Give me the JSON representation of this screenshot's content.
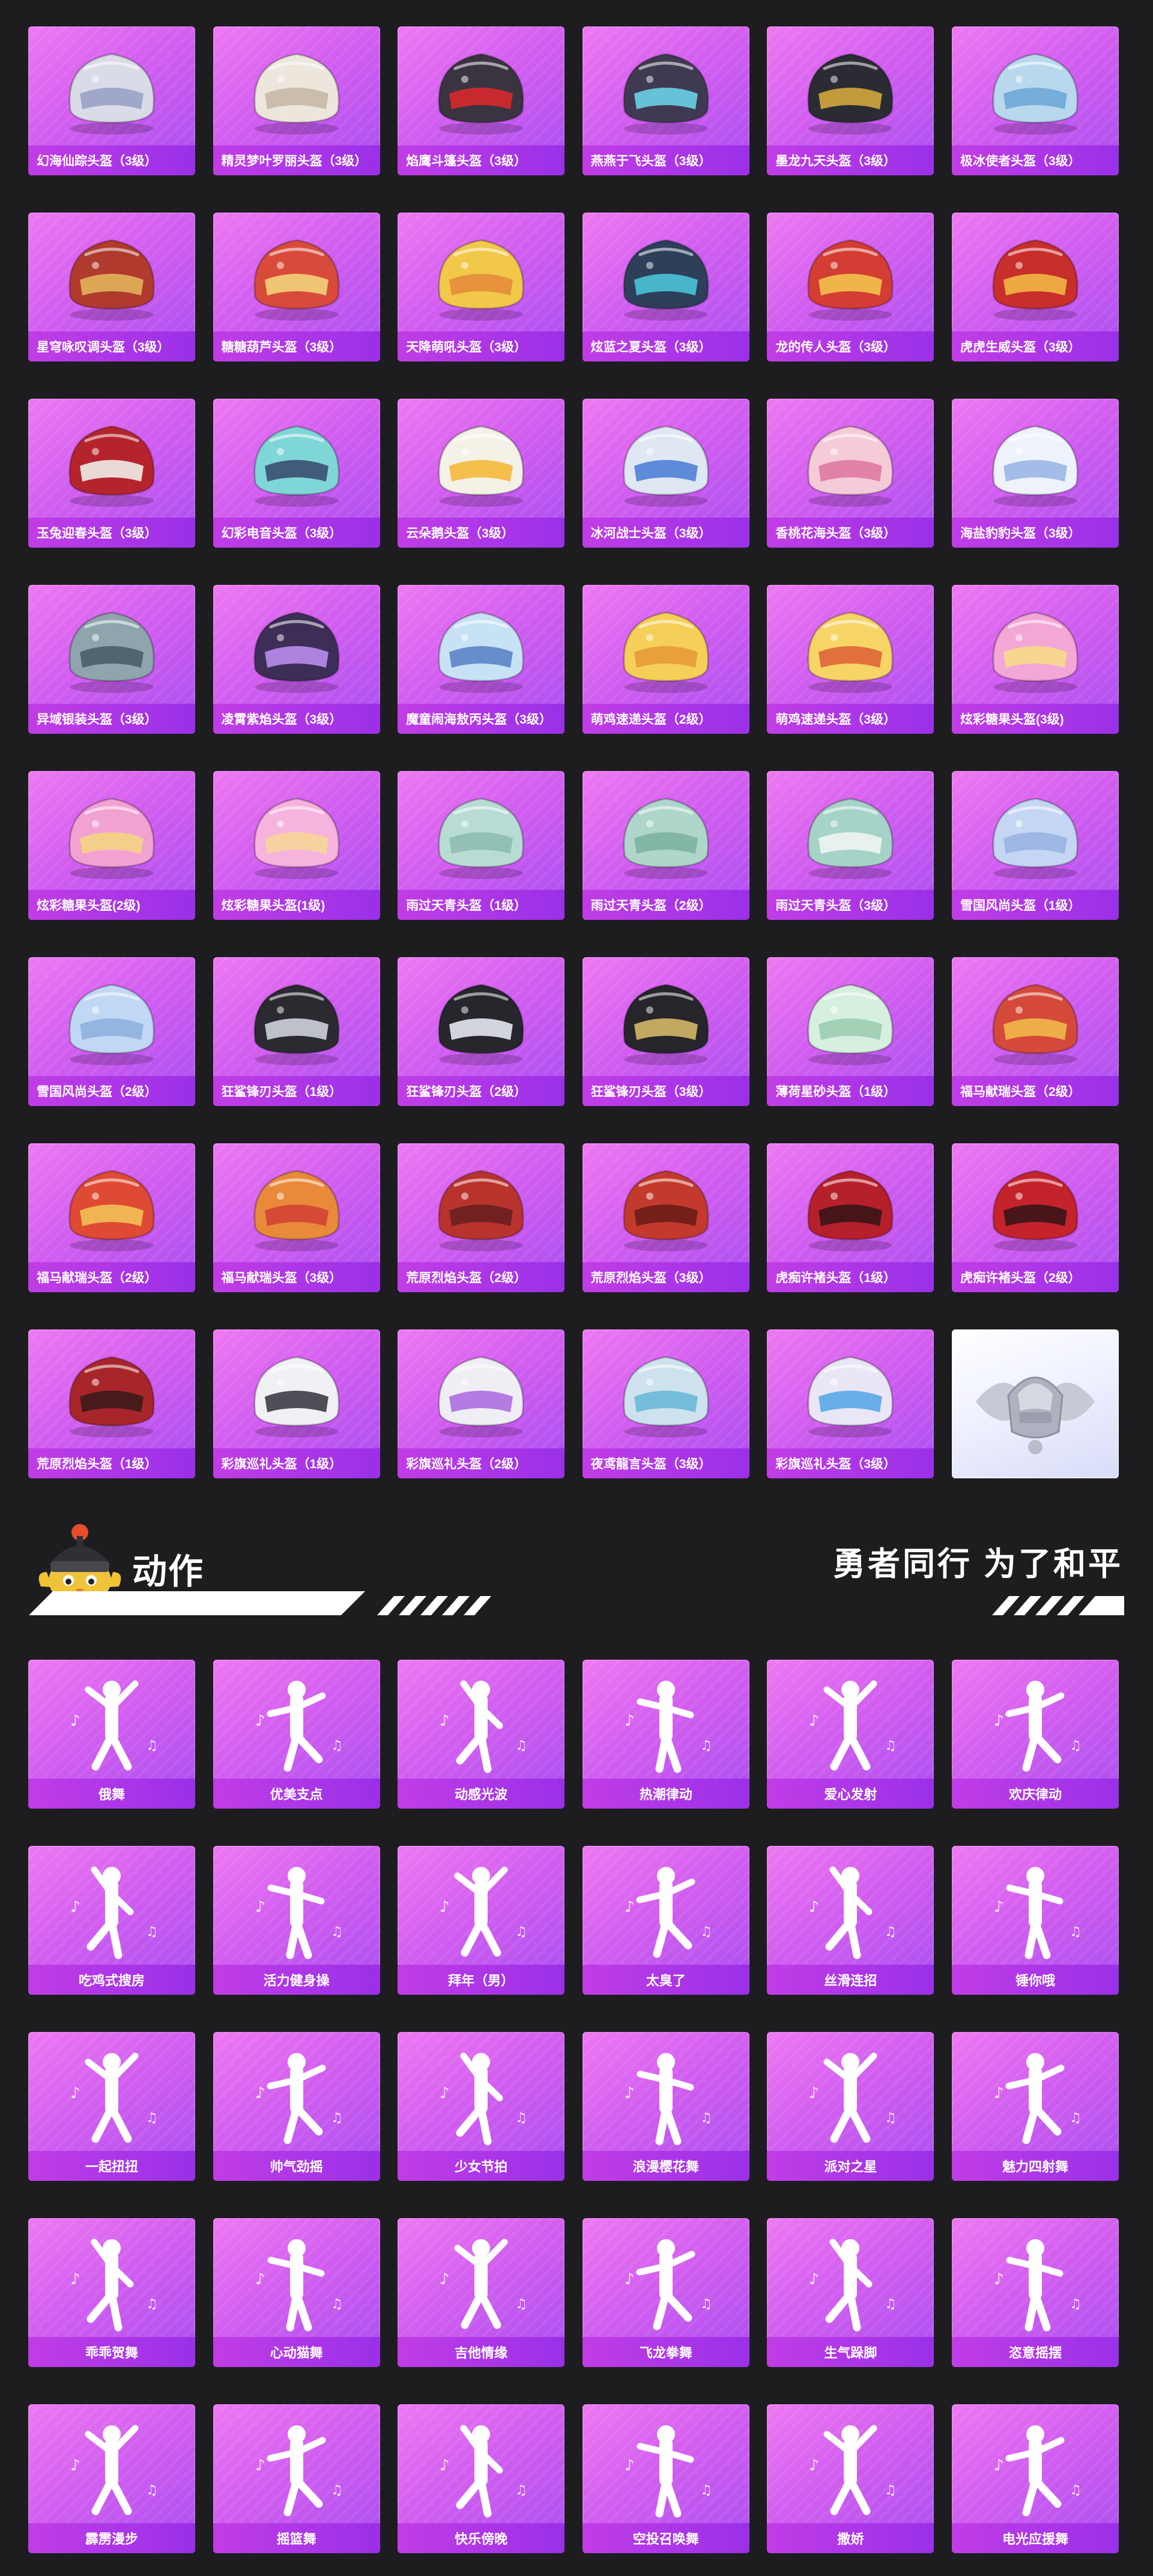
{
  "helmets": [
    {
      "name": "幻海仙踪头盔（3级）",
      "color": "#d9dbe6",
      "accent": "#9aa0c8"
    },
    {
      "name": "精灵梦叶罗丽头盔（3级）",
      "color": "#ece6dc",
      "accent": "#c7b8a6"
    },
    {
      "name": "焰鹰斗篷头盔（3级）",
      "color": "#3a3440",
      "accent": "#d8282c"
    },
    {
      "name": "燕燕于飞头盔（3级）",
      "color": "#3f3a52",
      "accent": "#6ad2e6"
    },
    {
      "name": "墨龙九天头盔（3级）",
      "color": "#2b2b33",
      "accent": "#d2a63c"
    },
    {
      "name": "极冰使者头盔（3级）",
      "color": "#b9d8ee",
      "accent": "#6fa8d6"
    },
    {
      "name": "星穹咏叹调头盔（3级）",
      "color": "#b13a2e",
      "accent": "#e2b25a"
    },
    {
      "name": "糖糖葫芦头盔（3级）",
      "color": "#d84b3a",
      "accent": "#f2d37a"
    },
    {
      "name": "天降萌吼头盔（3级）",
      "color": "#f1c84a",
      "accent": "#e58d3a"
    },
    {
      "name": "炫蓝之夏头盔（3级）",
      "color": "#2d3f59",
      "accent": "#4ac2d6"
    },
    {
      "name": "龙的传人头盔（3级）",
      "color": "#d43d34",
      "accent": "#f2c24c"
    },
    {
      "name": "虎虎生威头盔（3级）",
      "color": "#c82e2a",
      "accent": "#f0b744"
    },
    {
      "name": "玉兔迎春头盔（3级）",
      "color": "#b5242c",
      "accent": "#f0eee8"
    },
    {
      "name": "幻彩电音头盔（3级）",
      "color": "#7fd6d6",
      "accent": "#3b4e70"
    },
    {
      "name": "云朵鹅头盔（3级）",
      "color": "#f4f1e6",
      "accent": "#f5b93b"
    },
    {
      "name": "冰河战士头盔（3级）",
      "color": "#dfe7f3",
      "accent": "#4f7fd6"
    },
    {
      "name": "香桃花海头盔（3级）",
      "color": "#f6cbd8",
      "accent": "#e17aa3"
    },
    {
      "name": "海盐豹豹头盔（3级）",
      "color": "#eef3fb",
      "accent": "#9ab7e5"
    },
    {
      "name": "异域银装头盔（3级）",
      "color": "#8fa4ad",
      "accent": "#4a5e6a"
    },
    {
      "name": "凌霄紫焰头盔（3级）",
      "color": "#3d2e58",
      "accent": "#b98df0"
    },
    {
      "name": "魔童闹海敖丙头盔（3级）",
      "color": "#c7e2f4",
      "accent": "#5d84c8"
    },
    {
      "name": "萌鸡速递头盔（2级）",
      "color": "#f6cf58",
      "accent": "#e59a3a"
    },
    {
      "name": "萌鸡速递头盔（3级）",
      "color": "#f6d466",
      "accent": "#e0643a"
    },
    {
      "name": "炫彩糖果头盔(3级)",
      "color": "#f3a7d7",
      "accent": "#f6dc8a"
    },
    {
      "name": "炫彩糖果头盔(2级)",
      "color": "#f2a2d2",
      "accent": "#f4d483"
    },
    {
      "name": "炫彩糖果头盔(1级)",
      "color": "#f6b3dd",
      "accent": "#f6d59a"
    },
    {
      "name": "雨过天青头盔（1级）",
      "color": "#b8dcd3",
      "accent": "#8fbcb0"
    },
    {
      "name": "雨过天青头盔（2级）",
      "color": "#aed6cb",
      "accent": "#7fb2a4"
    },
    {
      "name": "雨过天青头盔（3级）",
      "color": "#a6d3c8",
      "accent": "#f0f4f2"
    },
    {
      "name": "雪国风尚头盔（1级）",
      "color": "#c4d6f3",
      "accent": "#9ab4e2"
    },
    {
      "name": "雪国风尚头盔（2级）",
      "color": "#c0d8f4",
      "accent": "#8fb0e0"
    },
    {
      "name": "狂鲨锋刃头盔（1级）",
      "color": "#2a2a30",
      "accent": "#cfd2da"
    },
    {
      "name": "狂鲨锋刃头盔（2级）",
      "color": "#26262c",
      "accent": "#e6e8ee"
    },
    {
      "name": "狂鲨锋刃头盔（3级）",
      "color": "#25252b",
      "accent": "#d4b766"
    },
    {
      "name": "薄荷星砂头盔（1级）",
      "color": "#d6efdf",
      "accent": "#9ccdb0"
    },
    {
      "name": "福马献瑞头盔（2级）",
      "color": "#d4493a",
      "accent": "#f0b84a"
    },
    {
      "name": "福马献瑞头盔（2级）",
      "color": "#de4a33",
      "accent": "#f3c056"
    },
    {
      "name": "福马献瑞头盔（3级）",
      "color": "#e88a3a",
      "accent": "#d24234"
    },
    {
      "name": "荒原烈焰头盔（2级）",
      "color": "#b8332c",
      "accent": "#6a1f1f"
    },
    {
      "name": "荒原烈焰头盔（3级）",
      "color": "#c33a2c",
      "accent": "#6d1d1a"
    },
    {
      "name": "虎痴许褚头盔（1级）",
      "color": "#b6202a",
      "accent": "#3a1418"
    },
    {
      "name": "虎痴许褚头盔（2级）",
      "color": "#c4232c",
      "accent": "#3a1418"
    },
    {
      "name": "荒原烈焰头盔（1级）",
      "color": "#a8262a",
      "accent": "#3c1a1a"
    },
    {
      "name": "彩旗巡礼头盔（1级）",
      "color": "#f1f1f5",
      "accent": "#3c3c46"
    },
    {
      "name": "彩旗巡礼头盔（2级）",
      "color": "#eeeef4",
      "accent": "#ad6fe0"
    },
    {
      "name": "夜鸢龍言头盔（3级）",
      "color": "#cde2ee",
      "accent": "#6ab8d6"
    },
    {
      "name": "彩旗巡礼头盔（3级）",
      "color": "#e9e7f6",
      "accent": "#5aa7e8"
    }
  ],
  "logo_tile": {
    "name": "pubg-emblem"
  },
  "section": {
    "title": "动作",
    "slogan": "勇者同行 为了和平"
  },
  "emotes": [
    {
      "name": "俄舞"
    },
    {
      "name": "优美支点"
    },
    {
      "name": "动感光波"
    },
    {
      "name": "热潮律动"
    },
    {
      "name": "爱心发射"
    },
    {
      "name": "欢庆律动"
    },
    {
      "name": "吃鸡式搜房"
    },
    {
      "name": "活力健身操"
    },
    {
      "name": "拜年（男）"
    },
    {
      "name": "太臭了"
    },
    {
      "name": "丝滑连招"
    },
    {
      "name": "锤你哦"
    },
    {
      "name": "一起扭扭"
    },
    {
      "name": "帅气劲摇"
    },
    {
      "name": "少女节拍"
    },
    {
      "name": "浪漫樱花舞"
    },
    {
      "name": "派对之星"
    },
    {
      "name": "魅力四射舞"
    },
    {
      "name": "乖乖贺舞"
    },
    {
      "name": "心动猫舞"
    },
    {
      "name": "吉他情缘"
    },
    {
      "name": "飞龙拳舞"
    },
    {
      "name": "生气跺脚"
    },
    {
      "name": "恣意摇摆"
    },
    {
      "name": "霹雳漫步"
    },
    {
      "name": "摇篮舞"
    },
    {
      "name": "快乐傍晚"
    },
    {
      "name": "空投召唤舞"
    },
    {
      "name": "撒娇"
    },
    {
      "name": "电光应援舞"
    }
  ],
  "colors": {
    "background": "#1d1d1f",
    "card_gradient_start": "#ee78f2",
    "card_gradient_end": "#a94ff0",
    "label_bar": "#b136e7"
  }
}
